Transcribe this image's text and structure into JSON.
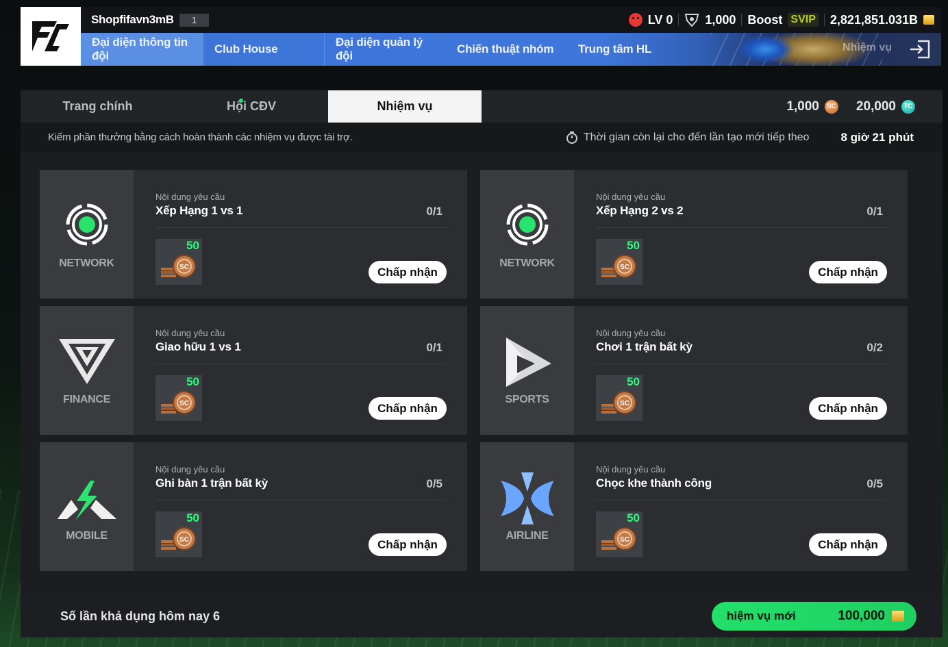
{
  "header": {
    "username": "Shopfifavn3mB",
    "user_level": "1",
    "lv_text": "LV 0",
    "shield_value": "1,000",
    "boost_label": "Boost",
    "svip_label": "SVIP",
    "gold_value": "2,821,851.031B"
  },
  "nav": {
    "items": [
      {
        "label": "Đại diện thông tin đội"
      },
      {
        "label": "Club House"
      },
      {
        "label": "Đại diện quản lý đội"
      },
      {
        "label": "Chiến thuật nhóm"
      },
      {
        "label": "Trung tâm HL"
      }
    ],
    "ghost_label": "Nhiệm vụ"
  },
  "tabs": {
    "main": "Trang chính",
    "fan": "Hội CĐV",
    "missions": "Nhiệm vụ"
  },
  "currency": {
    "sc_value": "1,000",
    "sc_icon": "SC",
    "tc_value": "20,000",
    "tc_icon": "TC"
  },
  "info": {
    "description": "Kiếm phần thưởng bằng cách hoàn thành các nhiệm vụ được tài trợ.",
    "timer_label": "Thời gian còn lại cho đến lần tạo mới tiếp theo",
    "timer_value": "8 giờ 21 phút"
  },
  "cards": [
    {
      "brand": "NETWORK",
      "req_label": "Nội dung yêu cầu",
      "mission": "Xếp Hạng 1 vs 1",
      "progress": "0/1",
      "reward": "50",
      "accept": "Chấp nhận"
    },
    {
      "brand": "NETWORK",
      "req_label": "Nội dung yêu cầu",
      "mission": "Xếp Hạng 2 vs 2",
      "progress": "0/1",
      "reward": "50",
      "accept": "Chấp nhận"
    },
    {
      "brand": "FINANCE",
      "req_label": "Nội dung yêu cầu",
      "mission": "Giao hữu 1 vs 1",
      "progress": "0/1",
      "reward": "50",
      "accept": "Chấp nhận"
    },
    {
      "brand": "SPORTS",
      "req_label": "Nội dung yêu cầu",
      "mission": "Chơi 1 trận bất kỳ",
      "progress": "0/2",
      "reward": "50",
      "accept": "Chấp nhận"
    },
    {
      "brand": "MOBILE",
      "req_label": "Nội dung yêu cầu",
      "mission": "Ghi bàn 1 trận bất kỳ",
      "progress": "0/5",
      "reward": "50",
      "accept": "Chấp nhận"
    },
    {
      "brand": "AIRLINE",
      "req_label": "Nội dung yêu cầu",
      "mission": "Chọc khe thành công",
      "progress": "0/5",
      "reward": "50",
      "accept": "Chấp nhận"
    }
  ],
  "footer": {
    "uses_today": "Số lần khả dụng hôm nay 6",
    "new_mission_label": "hiệm vụ mới",
    "new_mission_price": "100,000"
  },
  "colors": {
    "accent_green": "#22e06a",
    "nav_blue": "#3f76dc",
    "reward_green": "#29ff7e"
  },
  "icons": [
    "fc-logo",
    "sad-face-icon",
    "shield-icon",
    "gold-bars-icon",
    "exit-icon",
    "sc-coin-icon",
    "tc-coin-icon",
    "stopwatch-icon",
    "network-logo",
    "finance-logo",
    "sports-logo",
    "mobile-logo",
    "airline-logo",
    "sc-coins-stack-icon"
  ]
}
